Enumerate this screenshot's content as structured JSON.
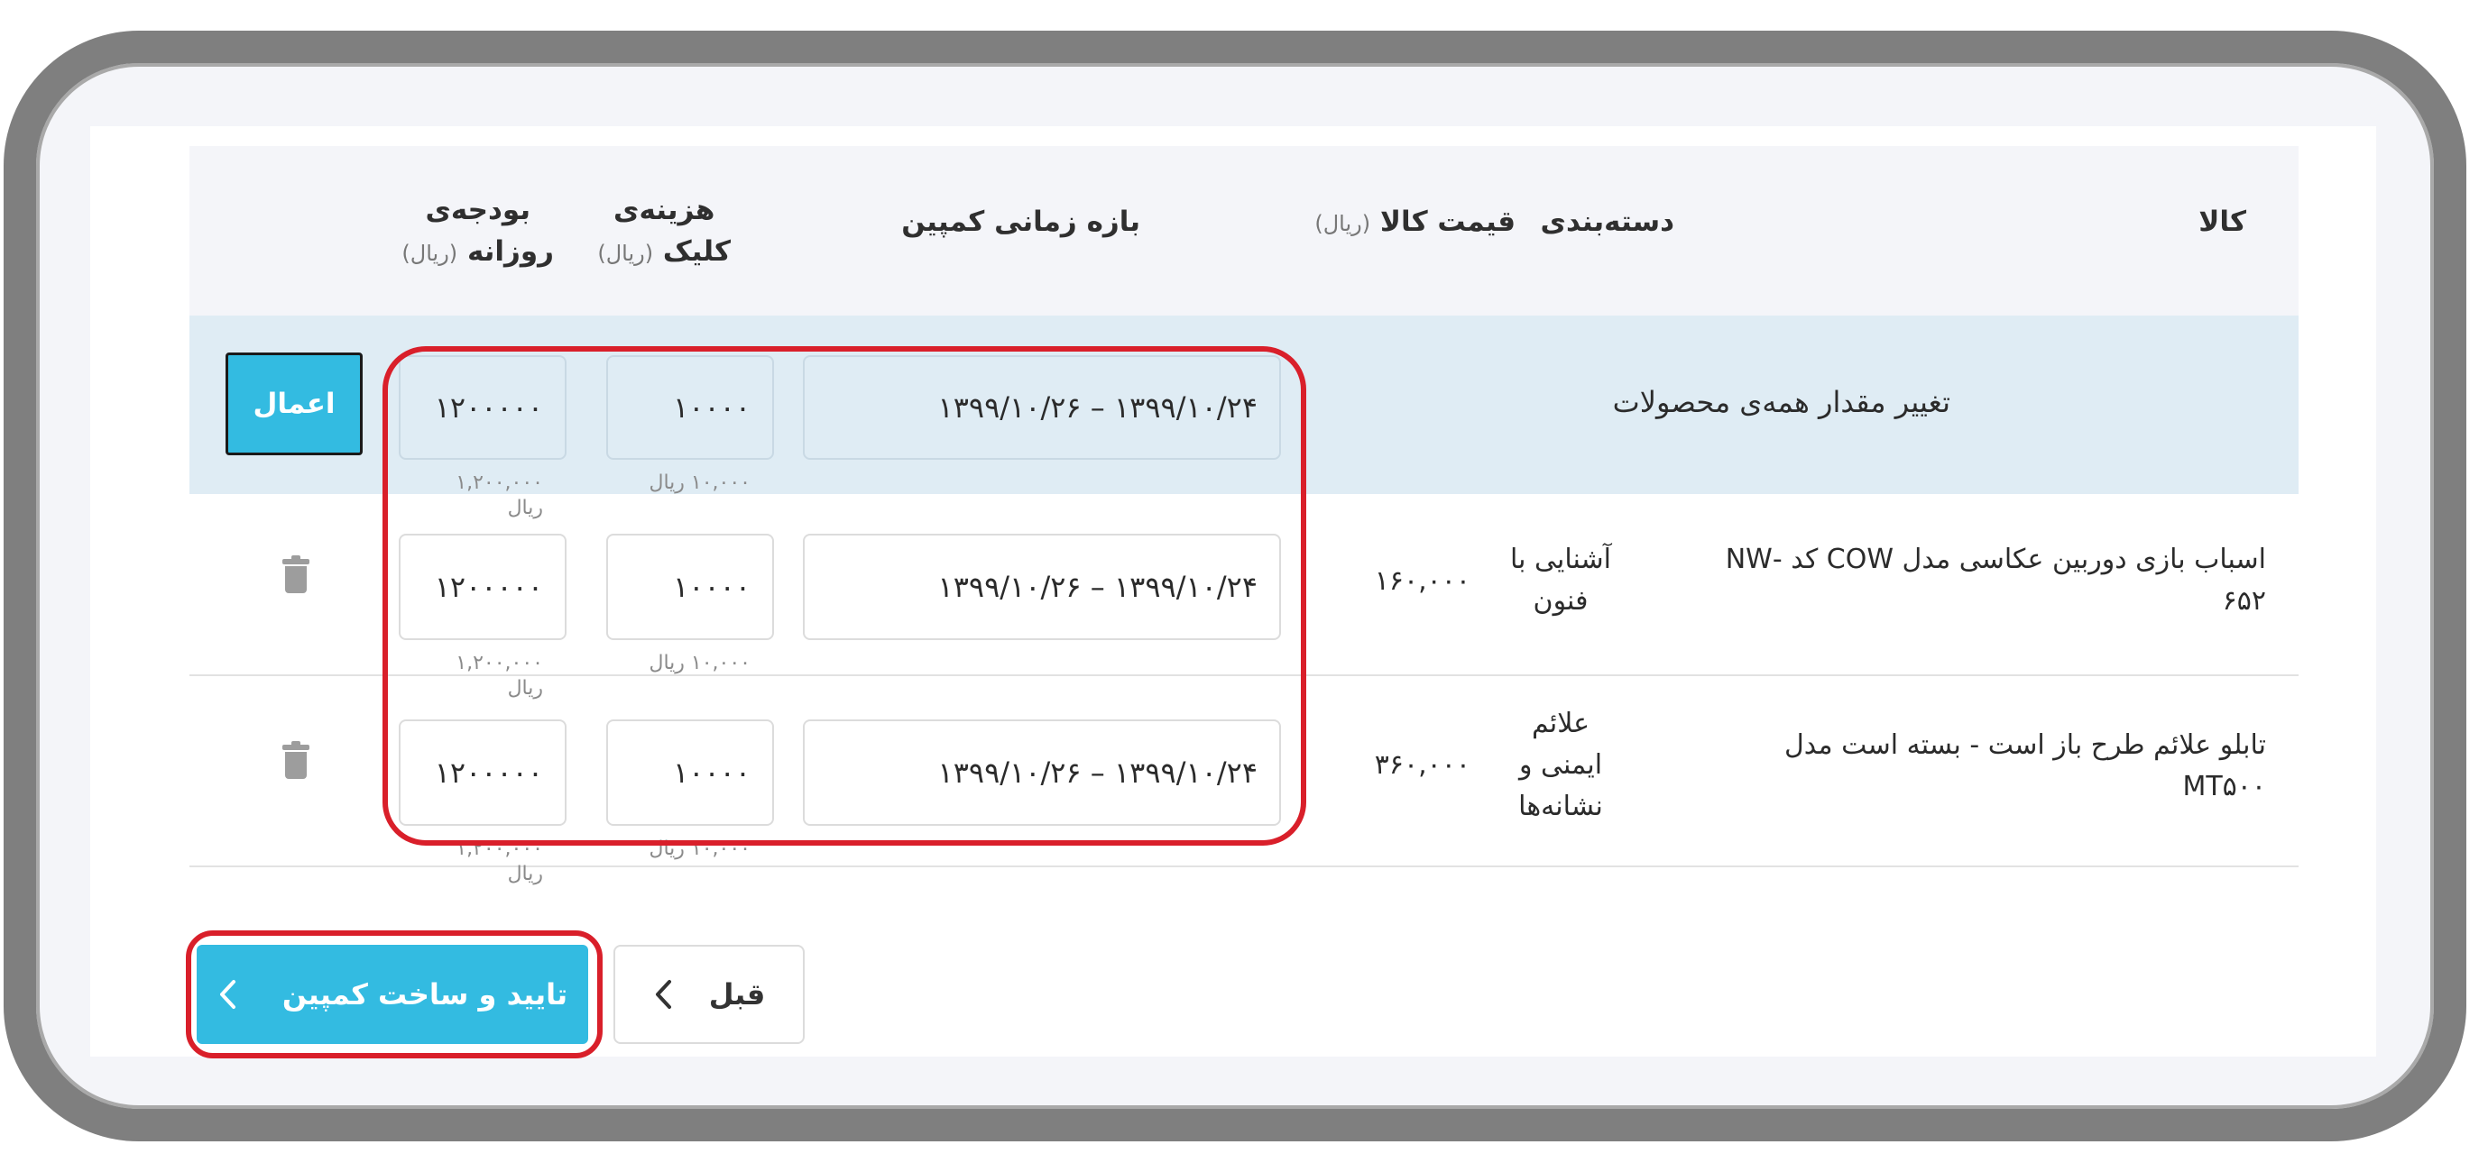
{
  "table": {
    "headers": {
      "product": "کالا",
      "category": "دسته‌بندی",
      "price": "قیمت کالا",
      "price_unit": "(ریال)",
      "period": "بازه زمانی کمپین",
      "click_cost_1": "هزینه‌ی",
      "click_cost_2": "کلیک",
      "click_cost_unit": "(ریال)",
      "budget_1": "بودجه‌ی",
      "budget_2": "روزانه",
      "budget_unit": "(ریال)"
    },
    "bulk": {
      "label": "تغییر مقدار همه‌ی محصولات",
      "period": "۱۳۹۹/۱۰/۲۴ – ۱۳۹۹/۱۰/۲۶",
      "click_cost": "۱۰۰۰۰",
      "click_cost_hint": "۱۰,۰۰۰ ریال",
      "budget": "۱۲۰۰۰۰۰",
      "budget_hint_1": "۱,۲۰۰,۰۰۰",
      "budget_hint_2": "ریال",
      "apply_label": "اعمال"
    },
    "rows": [
      {
        "product_1": "اسباب بازی دوربین عکاسی مدل COW کد -NW",
        "product_2": "۶۵۲",
        "category_1": "آشنایی با",
        "category_2": "فنون",
        "category_3": "",
        "price": "۱۶۰,۰۰۰",
        "period": "۱۳۹۹/۱۰/۲۴ – ۱۳۹۹/۱۰/۲۶",
        "click_cost": "۱۰۰۰۰",
        "click_cost_hint": "۱۰,۰۰۰ ریال",
        "budget": "۱۲۰۰۰۰۰",
        "budget_hint_1": "۱,۲۰۰,۰۰۰",
        "budget_hint_2": "ریال"
      },
      {
        "product_1": "تابلو علائم طرح باز است - بسته است مدل",
        "product_2": "MT۵۰۰",
        "category_1": "علائم",
        "category_2": "ایمنی و",
        "category_3": "نشانه‌ها",
        "price": "۳۶۰,۰۰۰",
        "period": "۱۳۹۹/۱۰/۲۴ – ۱۳۹۹/۱۰/۲۶",
        "click_cost": "۱۰۰۰۰",
        "click_cost_hint": "۱۰,۰۰۰ ریال",
        "budget": "۱۲۰۰۰۰۰",
        "budget_hint_1": "۱,۲۰۰,۰۰۰",
        "budget_hint_2": "ریال"
      }
    ]
  },
  "footer": {
    "prev_label": "قبل",
    "confirm_label": "تایید و ساخت کمپین"
  },
  "colors": {
    "accent": "#33bbe1",
    "highlight": "#d91f2a",
    "bulk_row_bg": "#dfecf4",
    "header_bg": "#f4f5f9"
  }
}
